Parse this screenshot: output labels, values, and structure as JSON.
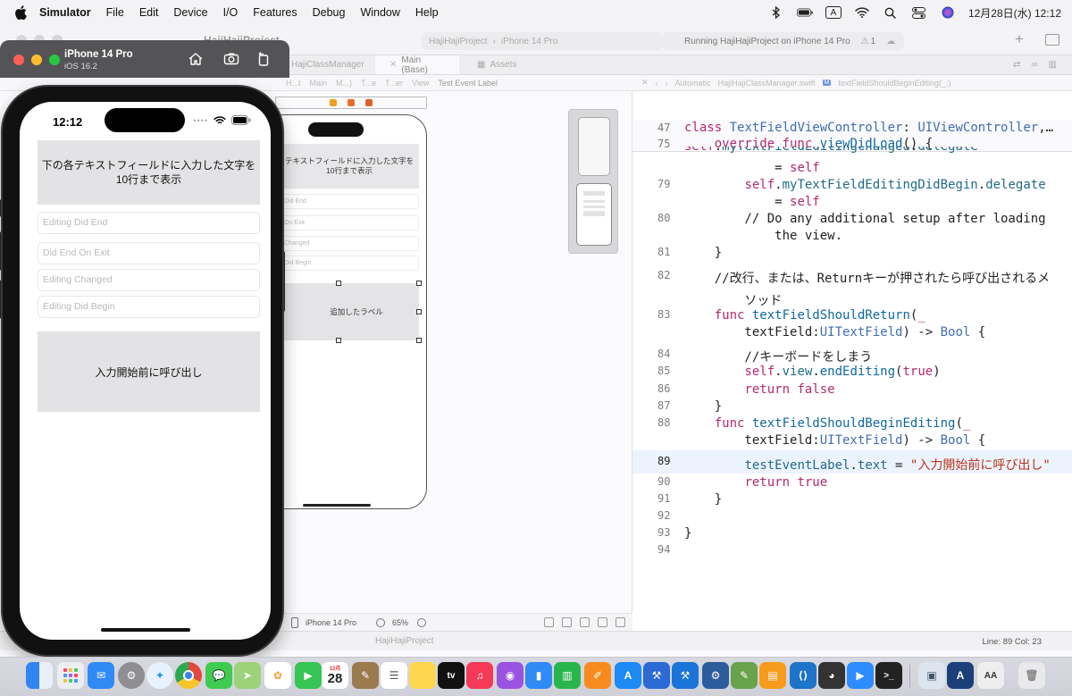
{
  "menubar": {
    "app": "Simulator",
    "items": [
      "File",
      "Edit",
      "Device",
      "I/O",
      "Features",
      "Debug",
      "Window",
      "Help"
    ],
    "input_indicator": "A",
    "clock": "12月28日(水)  12:12"
  },
  "xcode": {
    "project_title": "HajiHajiProject",
    "scheme": "HajiHajiProject",
    "destination": "iPhone 14 Pro",
    "status": "Running HajiHajiProject on iPhone 14 Pro",
    "warning_count": "1",
    "tabs": [
      "HajiClassManager",
      "Main (Base)",
      "Assets"
    ],
    "jumpbar_left": [
      "HajiHajiProject",
      "H...t",
      "Main",
      "M...)",
      "T...e",
      "T...er",
      "View",
      "Test Event Label"
    ],
    "jumpbar_right": [
      "Automatic",
      "HajiHajiClassManager.swift",
      "textFieldShouldBeginEditing(_:)"
    ],
    "storyboard": {
      "header_text": "テキストフィールドに入力した文字を10行まで表示",
      "fields": [
        "Did End",
        "On Exit",
        "Changed",
        "Did Begin"
      ],
      "label_text": "追加したラベル",
      "device": "iPhone 14 Pro",
      "zoom": "65%"
    },
    "status_bar": {
      "position": "Line: 89  Col: 23",
      "breadcrumb": "HajiHajiProject"
    }
  },
  "code": {
    "sticky": [
      {
        "num": "47",
        "text": "class TextFieldViewController: UIViewController,…"
      },
      {
        "num": "75",
        "text": "    override func viewDidLoad() {"
      }
    ],
    "lines": [
      {
        "num": "79",
        "text": "        self.myTextFieldEditingDidBegin.delegate"
      },
      {
        "num": "",
        "text": "            = self"
      },
      {
        "num": "80",
        "text": "        // Do any additional setup after loading"
      },
      {
        "num": "",
        "text": "            the view."
      },
      {
        "num": "81",
        "text": "    }"
      },
      {
        "num": "82",
        "text": "    //改行、または、Returnキーが押されたら呼び出されるメ"
      },
      {
        "num": "",
        "text": "        ソッド"
      },
      {
        "num": "83",
        "text": "    func textFieldShouldReturn(_"
      },
      {
        "num": "",
        "text": "        textField:UITextField) -> Bool {"
      },
      {
        "num": "84",
        "text": "        //キーボードをしまう"
      },
      {
        "num": "85",
        "text": "        self.view.endEditing(true)"
      },
      {
        "num": "86",
        "text": "        return false"
      },
      {
        "num": "87",
        "text": "    }"
      },
      {
        "num": "88",
        "text": "    func textFieldShouldBeginEditing(_"
      },
      {
        "num": "",
        "text": "        textField:UITextField) -> Bool {"
      },
      {
        "num": "89",
        "text": "        testEventLabel.text = \"入力開始前に呼び出し\""
      },
      {
        "num": "90",
        "text": "        return true"
      },
      {
        "num": "91",
        "text": "    }"
      },
      {
        "num": "92",
        "text": ""
      },
      {
        "num": "93",
        "text": "}"
      },
      {
        "num": "94",
        "text": ""
      }
    ],
    "partial_top": "        self.myTextFieldEditingChanged.delegate",
    "partial_top_cont": "            = self",
    "current_line": "89"
  },
  "simulator": {
    "device_name": "iPhone 14 Pro",
    "os": "iOS 16.2",
    "time": "12:12",
    "header_text": "下の各テキストフィールドに入力した文字を10行まで表示",
    "placeholders": [
      "Editing Did End",
      "Did End On Exit",
      "Editing Changed",
      "Editing Did Begin"
    ],
    "event_label": "入力開始前に呼び出し"
  },
  "dock": {
    "calendar_day": "28",
    "calendar_month": "12月",
    "apps": [
      "Finder",
      "Launchpad",
      "Mail",
      "System Settings",
      "Safari",
      "Chrome",
      "Messages",
      "Maps",
      "Photos",
      "FaceTime",
      "Calendar",
      "Notes App",
      "Reminders",
      "Notes",
      "Apple TV",
      "Music",
      "Podcasts",
      "Keynote",
      "Numbers",
      "Pages",
      "App Store",
      "Xcode Tool",
      "Xcode",
      "Instruments",
      "Script Editor",
      "Books",
      "VS Code",
      "Discord",
      "Zoom",
      "Terminal",
      "Preview",
      "Xcode Dev",
      "Font Book",
      "Trash"
    ],
    "colors": {
      "finder": "#3a8df0",
      "mail": "#2f8af5",
      "safari": "#1d8ff5",
      "chrome": "#e2483d",
      "messages": "#3fcb4f",
      "photos": "#f6a03a",
      "facetime": "#36c453",
      "music": "#f43a56",
      "podcasts": "#9a52e0",
      "keynote": "#2f8af5",
      "numbers": "#29b54d",
      "pages": "#f78b1e",
      "appstore": "#1c8af5",
      "vscode": "#1e74c8",
      "zoom": "#2d8cff",
      "terminal": "#222"
    }
  }
}
